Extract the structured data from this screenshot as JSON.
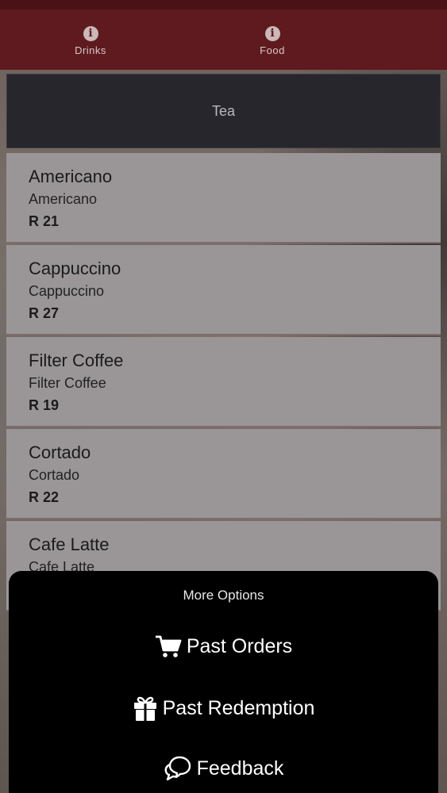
{
  "tabs": [
    {
      "label": "Drinks",
      "icon": "info-icon"
    },
    {
      "label": "Food",
      "icon": "info-icon"
    }
  ],
  "category": {
    "label": "Tea"
  },
  "items": [
    {
      "name": "Americano",
      "desc": "Americano",
      "price": "R 21"
    },
    {
      "name": "Cappuccino",
      "desc": "Cappuccino",
      "price": "R 27"
    },
    {
      "name": "Filter Coffee",
      "desc": "Filter Coffee",
      "price": "R 19"
    },
    {
      "name": "Cortado",
      "desc": "Cortado",
      "price": "R 22"
    },
    {
      "name": "Cafe Latte",
      "desc": "Cafe Latte",
      "price": ""
    }
  ],
  "sheet": {
    "title": "More Options",
    "options": [
      {
        "label": "Past Orders",
        "icon": "cart-icon"
      },
      {
        "label": "Past Redemption",
        "icon": "gift-icon"
      },
      {
        "label": "Feedback",
        "icon": "chat-bubbles-icon"
      }
    ]
  }
}
